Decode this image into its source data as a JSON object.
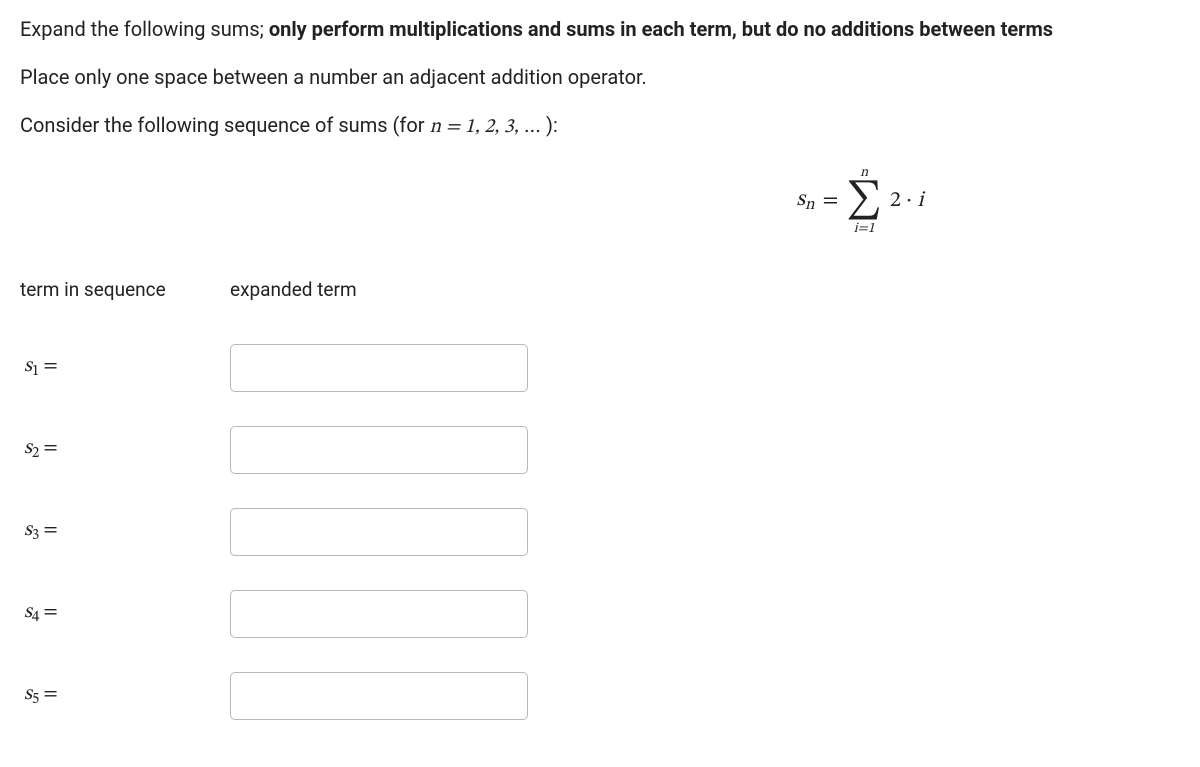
{
  "instructions": {
    "line1_normal": "Expand the following sums; ",
    "line1_bold": "only perform multiplications and sums in each term, but do no additions between terms",
    "line2": "Place only one space between a number an adjacent addition operator.",
    "line3_prefix": "Consider the following sequence of sums (for  ",
    "line3_math": "n = 1, 2, 3, …",
    "line3_suffix": " ):"
  },
  "formula": {
    "lhs_var": "s",
    "lhs_sub": "n",
    "equals": "=",
    "sigma_top": "n",
    "sigma_bottom": "i=1",
    "summand_coef": "2",
    "summand_dot": " · ",
    "summand_var": "i"
  },
  "headers": {
    "col1": "term in sequence",
    "col2": "expanded term"
  },
  "rows": [
    {
      "var": "s",
      "sub": "1",
      "eq": "=",
      "value": ""
    },
    {
      "var": "s",
      "sub": "2",
      "eq": "=",
      "value": ""
    },
    {
      "var": "s",
      "sub": "3",
      "eq": "=",
      "value": ""
    },
    {
      "var": "s",
      "sub": "4",
      "eq": "=",
      "value": ""
    },
    {
      "var": "s",
      "sub": "5",
      "eq": "=",
      "value": ""
    }
  ]
}
